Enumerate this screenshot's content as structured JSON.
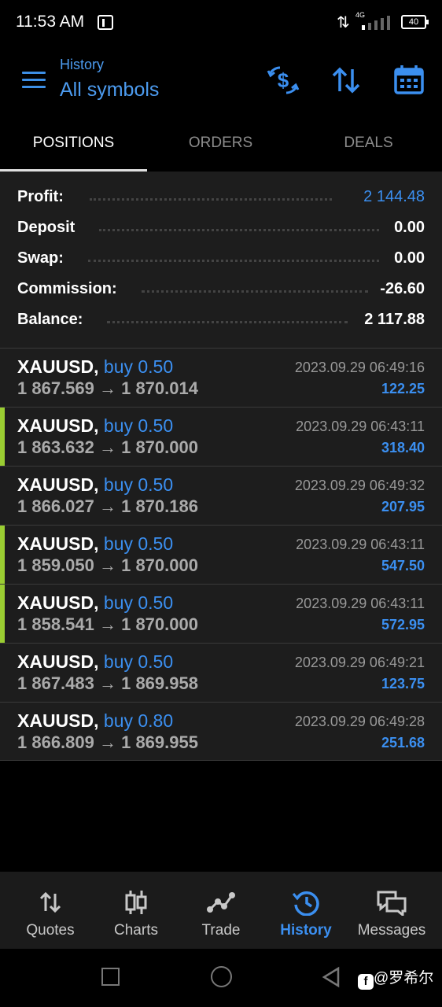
{
  "status_bar": {
    "time": "11:53 AM",
    "network": "4G",
    "battery": "40"
  },
  "header": {
    "subtitle": "History",
    "title": "All symbols"
  },
  "tabs": [
    {
      "label": "POSITIONS",
      "active": true
    },
    {
      "label": "ORDERS",
      "active": false
    },
    {
      "label": "DEALS",
      "active": false
    }
  ],
  "summary": {
    "profit_label": "Profit:",
    "profit_value": "2 144.48",
    "deposit_label": "Deposit",
    "deposit_value": "0.00",
    "swap_label": "Swap:",
    "swap_value": "0.00",
    "commission_label": "Commission:",
    "commission_value": "-26.60",
    "balance_label": "Balance:",
    "balance_value": "2 117.88"
  },
  "positions": [
    {
      "symbol": "XAUUSD,",
      "direction": "buy 0.50",
      "prices": "1 867.569 → 1 870.014",
      "time": "2023.09.29 06:49:16",
      "profit": "122.25",
      "highlighted": false
    },
    {
      "symbol": "XAUUSD,",
      "direction": "buy 0.50",
      "prices": "1 863.632 → 1 870.000",
      "time": "2023.09.29 06:43:11",
      "profit": "318.40",
      "highlighted": true
    },
    {
      "symbol": "XAUUSD,",
      "direction": "buy 0.50",
      "prices": "1 866.027 → 1 870.186",
      "time": "2023.09.29 06:49:32",
      "profit": "207.95",
      "highlighted": false
    },
    {
      "symbol": "XAUUSD,",
      "direction": "buy 0.50",
      "prices": "1 859.050 → 1 870.000",
      "time": "2023.09.29 06:43:11",
      "profit": "547.50",
      "highlighted": true
    },
    {
      "symbol": "XAUUSD,",
      "direction": "buy 0.50",
      "prices": "1 858.541 → 1 870.000",
      "time": "2023.09.29 06:43:11",
      "profit": "572.95",
      "highlighted": true
    },
    {
      "symbol": "XAUUSD,",
      "direction": "buy 0.50",
      "prices": "1 867.483 → 1 869.958",
      "time": "2023.09.29 06:49:21",
      "profit": "123.75",
      "highlighted": false
    },
    {
      "symbol": "XAUUSD,",
      "direction": "buy 0.80",
      "prices": "1 866.809 → 1 869.955",
      "time": "2023.09.29 06:49:28",
      "profit": "251.68",
      "highlighted": false
    }
  ],
  "bottom_nav": [
    {
      "label": "Quotes",
      "icon": "quotes-icon",
      "active": false
    },
    {
      "label": "Charts",
      "icon": "charts-icon",
      "active": false
    },
    {
      "label": "Trade",
      "icon": "trade-icon",
      "active": false
    },
    {
      "label": "History",
      "icon": "history-icon",
      "active": true
    },
    {
      "label": "Messages",
      "icon": "messages-icon",
      "active": false
    }
  ],
  "watermark": "@罗希尔",
  "colors": {
    "accent": "#3b8ff0",
    "highlight": "#9acd32",
    "background": "#000000",
    "panel": "#1d1d1d"
  }
}
